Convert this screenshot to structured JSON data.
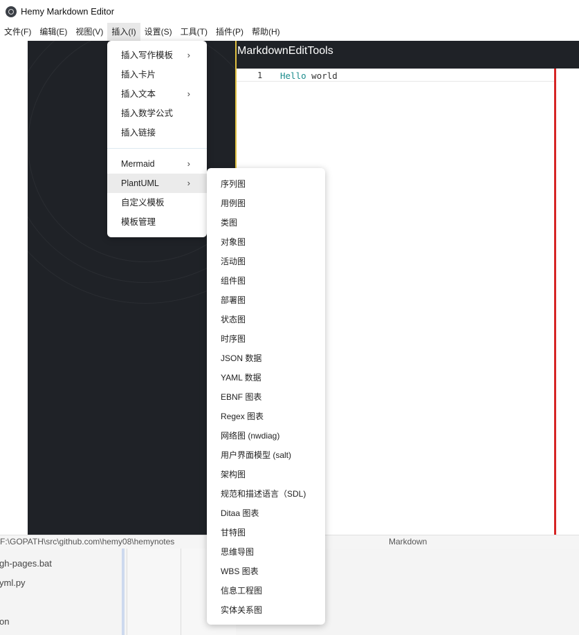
{
  "window": {
    "title": "Hemy Markdown Editor",
    "menubar": [
      "文件(F)",
      "编辑(E)",
      "视图(V)",
      "插入(I)",
      "设置(S)",
      "工具(T)",
      "插件(P)",
      "帮助(H)"
    ]
  },
  "editor": {
    "toolbar_title": "MarkdownEditTools",
    "line_number": "1",
    "code_keyword": "Hello",
    "code_text": " world"
  },
  "statusbar": {
    "path": "F:\\GOPATH\\src\\github.com\\hemy08\\hemynotes",
    "mode": "Markdown"
  },
  "insert_menu": {
    "items": [
      {
        "label": "插入写作模板",
        "arrow": "›"
      },
      {
        "label": "插入卡片",
        "arrow": ""
      },
      {
        "label": "插入文本",
        "arrow": "›"
      },
      {
        "label": "插入数学公式",
        "arrow": ""
      },
      {
        "label": "插入链接",
        "arrow": ""
      },
      {
        "label": "Mermaid",
        "arrow": "›"
      },
      {
        "label": "PlantUML",
        "arrow": "›"
      },
      {
        "label": "自定义模板",
        "arrow": ""
      },
      {
        "label": "模板管理",
        "arrow": ""
      }
    ]
  },
  "plantuml_menu": {
    "items": [
      "序列图",
      "用例图",
      "类图",
      "对象图",
      "活动图",
      "组件图",
      "部署图",
      "状态图",
      "时序图",
      "JSON 数据",
      "YAML 数据",
      "EBNF 图表",
      "Regex 图表",
      "网络图 (nwdiag)",
      "用户界面模型 (salt)",
      "架构图",
      "规范和描述语言（SDL)",
      "Ditaa 图表",
      "甘特图",
      "思维导图",
      "WBS 图表",
      "信息工程图",
      "实体关系图"
    ]
  },
  "background_files": [
    "gh-pages.bat",
    "yml.py",
    "on"
  ],
  "colors": {
    "dark_pane": "#1f2227",
    "divider": "#e0c040",
    "cursor_bar": "#d62424",
    "keyword": "#1c8c8c"
  }
}
